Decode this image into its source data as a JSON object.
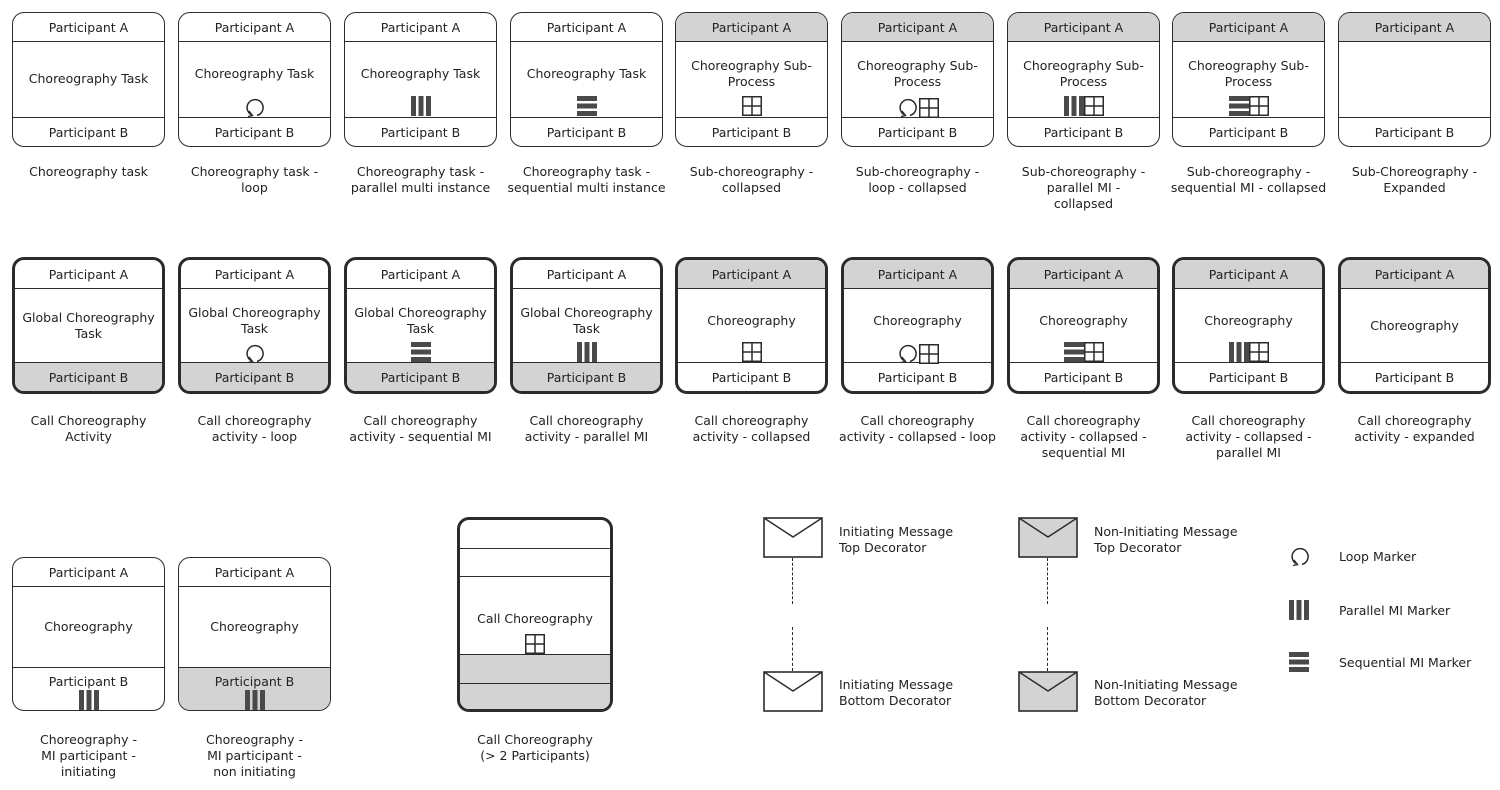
{
  "colors": {
    "stroke": "#2b2b2b",
    "shade": "#d3d3d3",
    "marker": "#4a4a4a"
  },
  "row1": [
    {
      "top": "Participant A",
      "topShaded": false,
      "body": [
        "Choreography Task"
      ],
      "bottom": "Participant B",
      "bottomShaded": false,
      "markers": [],
      "caption": [
        "Choreography task"
      ]
    },
    {
      "top": "Participant A",
      "topShaded": false,
      "body": [
        "Choreography Task"
      ],
      "bottom": "Participant B",
      "bottomShaded": false,
      "markers": [
        "loop"
      ],
      "caption": [
        "Choreography task -",
        "loop"
      ]
    },
    {
      "top": "Participant A",
      "topShaded": false,
      "body": [
        "Choreography Task"
      ],
      "bottom": "Participant B",
      "bottomShaded": false,
      "markers": [
        "parallel"
      ],
      "caption": [
        "Choreography task -",
        "parallel multi instance"
      ]
    },
    {
      "top": "Participant A",
      "topShaded": false,
      "body": [
        "Choreography Task"
      ],
      "bottom": "Participant B",
      "bottomShaded": false,
      "markers": [
        "sequential"
      ],
      "caption": [
        "Choreography task -",
        "sequential multi instance"
      ]
    },
    {
      "top": "Participant A",
      "topShaded": true,
      "body": [
        "Choreography Sub-",
        "Process"
      ],
      "bottom": "Participant B",
      "bottomShaded": false,
      "markers": [
        "subprocess"
      ],
      "caption": [
        "Sub-choreography -",
        "collapsed"
      ]
    },
    {
      "top": "Participant A",
      "topShaded": true,
      "body": [
        "Choreography Sub-",
        "Process"
      ],
      "bottom": "Participant B",
      "bottomShaded": false,
      "markers": [
        "loop",
        "subprocess"
      ],
      "caption": [
        "Sub-choreography -",
        "loop - collapsed"
      ]
    },
    {
      "top": "Participant A",
      "topShaded": true,
      "body": [
        "Choreography Sub-",
        "Process"
      ],
      "bottom": "Participant B",
      "bottomShaded": false,
      "markers": [
        "parallel",
        "subprocess"
      ],
      "caption": [
        "Sub-choreography -",
        "parallel MI -",
        "collapsed"
      ]
    },
    {
      "top": "Participant A",
      "topShaded": true,
      "body": [
        "Choreography Sub-",
        "Process"
      ],
      "bottom": "Participant B",
      "bottomShaded": false,
      "markers": [
        "sequential",
        "subprocess"
      ],
      "caption": [
        "Sub-choreography -",
        "sequential MI - collapsed"
      ]
    },
    {
      "top": "Participant A",
      "topShaded": true,
      "body": [],
      "bottom": "Participant B",
      "bottomShaded": false,
      "markers": [],
      "caption": [
        "Sub-Choreography -",
        "Expanded"
      ]
    }
  ],
  "row2": [
    {
      "top": "Participant A",
      "topShaded": false,
      "body": [
        "Global Choreography",
        "Task"
      ],
      "bottom": "Participant B",
      "bottomShaded": true,
      "markers": [],
      "caption": [
        "Call Choreography",
        "Activity"
      ]
    },
    {
      "top": "Participant A",
      "topShaded": false,
      "body": [
        "Global Choreography",
        "Task"
      ],
      "bottom": "Participant B",
      "bottomShaded": true,
      "markers": [
        "loop"
      ],
      "caption": [
        "Call choreography",
        "activity - loop"
      ]
    },
    {
      "top": "Participant A",
      "topShaded": false,
      "body": [
        "Global Choreography",
        "Task"
      ],
      "bottom": "Participant B",
      "bottomShaded": true,
      "markers": [
        "sequential"
      ],
      "caption": [
        "Call choreography",
        "activity - sequential MI"
      ]
    },
    {
      "top": "Participant A",
      "topShaded": false,
      "body": [
        "Global Choreography",
        "Task"
      ],
      "bottom": "Participant B",
      "bottomShaded": true,
      "markers": [
        "parallel"
      ],
      "caption": [
        "Call choreography",
        "activity - parallel MI"
      ]
    },
    {
      "top": "Participant A",
      "topShaded": true,
      "body": [
        "Choreography"
      ],
      "bottom": "Participant B",
      "bottomShaded": false,
      "markers": [
        "subprocess"
      ],
      "caption": [
        "Call choreography",
        "activity - collapsed"
      ]
    },
    {
      "top": "Participant A",
      "topShaded": true,
      "body": [
        "Choreography"
      ],
      "bottom": "Participant B",
      "bottomShaded": false,
      "markers": [
        "loop",
        "subprocess"
      ],
      "caption": [
        "Call choreography",
        "activity - collapsed - loop"
      ]
    },
    {
      "top": "Participant A",
      "topShaded": true,
      "body": [
        "Choreography"
      ],
      "bottom": "Participant B",
      "bottomShaded": false,
      "markers": [
        "sequential",
        "subprocess"
      ],
      "caption": [
        "Call choreography",
        "activity - collapsed -",
        "sequential MI"
      ]
    },
    {
      "top": "Participant A",
      "topShaded": true,
      "body": [
        "Choreography"
      ],
      "bottom": "Participant B",
      "bottomShaded": false,
      "markers": [
        "parallel",
        "subprocess"
      ],
      "caption": [
        "Call choreography",
        "activity - collapsed -",
        "parallel MI"
      ]
    },
    {
      "top": "Participant A",
      "topShaded": true,
      "body": [
        "Choreography"
      ],
      "bottom": "Participant B",
      "bottomShaded": false,
      "markers": [],
      "caption": [
        "Call choreography",
        "activity - expanded"
      ]
    }
  ],
  "row3": [
    {
      "top": "Participant A",
      "topShaded": false,
      "body": [
        "Choreography"
      ],
      "bottom": "Participant B",
      "bottomShaded": false,
      "bottomMarkers": [
        "parallel"
      ],
      "caption": [
        "Choreography -",
        "MI participant -",
        "initiating"
      ]
    },
    {
      "top": "Participant A",
      "topShaded": false,
      "body": [
        "Choreography"
      ],
      "bottom": "Participant B",
      "bottomShaded": true,
      "bottomMarkers": [
        "parallel"
      ],
      "caption": [
        "Choreography -",
        "MI participant -",
        "non initiating"
      ]
    }
  ],
  "multi": {
    "body": "Call Choreography",
    "markers": [
      "subprocess"
    ],
    "bands_shaded": [
      false,
      false,
      true,
      true
    ],
    "caption": [
      "Call Choreography",
      "(> 2 Participants)"
    ]
  },
  "messages": [
    {
      "shaded": false,
      "top_label": [
        "Initiating Message",
        "Top Decorator"
      ],
      "bottom_label": [
        "Initiating Message",
        "Bottom Decorator"
      ]
    },
    {
      "shaded": true,
      "top_label": [
        "Non-Initiating Message",
        "Top Decorator"
      ],
      "bottom_label": [
        "Non-Initiating Message",
        "Bottom Decorator"
      ]
    }
  ],
  "legend": [
    {
      "icon": "loop",
      "label": "Loop Marker"
    },
    {
      "icon": "parallel",
      "label": "Parallel MI Marker"
    },
    {
      "icon": "sequential",
      "label": "Sequential MI Marker"
    }
  ]
}
